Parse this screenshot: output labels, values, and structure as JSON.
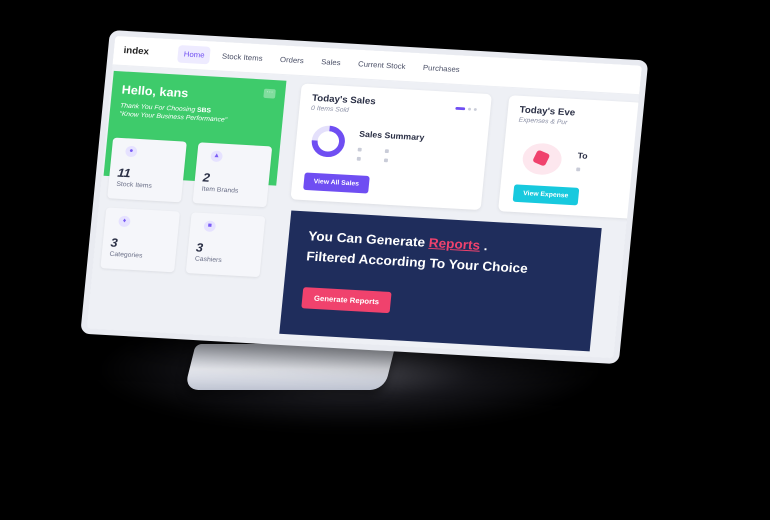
{
  "navbar": {
    "brand": "index",
    "items": [
      {
        "label": "Home",
        "active": true
      },
      {
        "label": "Stock Items"
      },
      {
        "label": "Orders"
      },
      {
        "label": "Sales"
      },
      {
        "label": "Current Stock"
      },
      {
        "label": "Purchases"
      }
    ]
  },
  "welcome": {
    "title": "Hello, kans",
    "line1_prefix": "Thank You For Choosing ",
    "line1_brand": "SBS",
    "line2": "\"Know Your Business Performance\"",
    "stats": [
      {
        "value": "11",
        "label": "Stock Items",
        "icon": "user-icon"
      },
      {
        "value": "2",
        "label": "Item Brands",
        "icon": "tag-icon"
      },
      {
        "value": "3",
        "label": "Categories",
        "icon": "trophy-icon"
      },
      {
        "value": "3",
        "label": "Cashiers",
        "icon": "cashier-icon"
      }
    ]
  },
  "sales_card": {
    "title": "Today's Sales",
    "subtitle": "0 Items Sold",
    "summary_title": "Sales Summary",
    "button": "View All Sales"
  },
  "expenses_card": {
    "title": "Today's Eve",
    "subtitle": "Expenses & Pur",
    "side_text": "To",
    "button": "View Expense"
  },
  "banner": {
    "line1_prefix": "You Can Generate ",
    "line1_accent": "Reports",
    "line1_suffix": " .",
    "line2": "Filtered According To Your Choice",
    "button": "Generate Reports"
  },
  "colors": {
    "accent": "#6f4ef2",
    "green": "#3ecb6b",
    "pink": "#f0426d",
    "cyan": "#17c9de",
    "navy": "#1f2d5c"
  }
}
